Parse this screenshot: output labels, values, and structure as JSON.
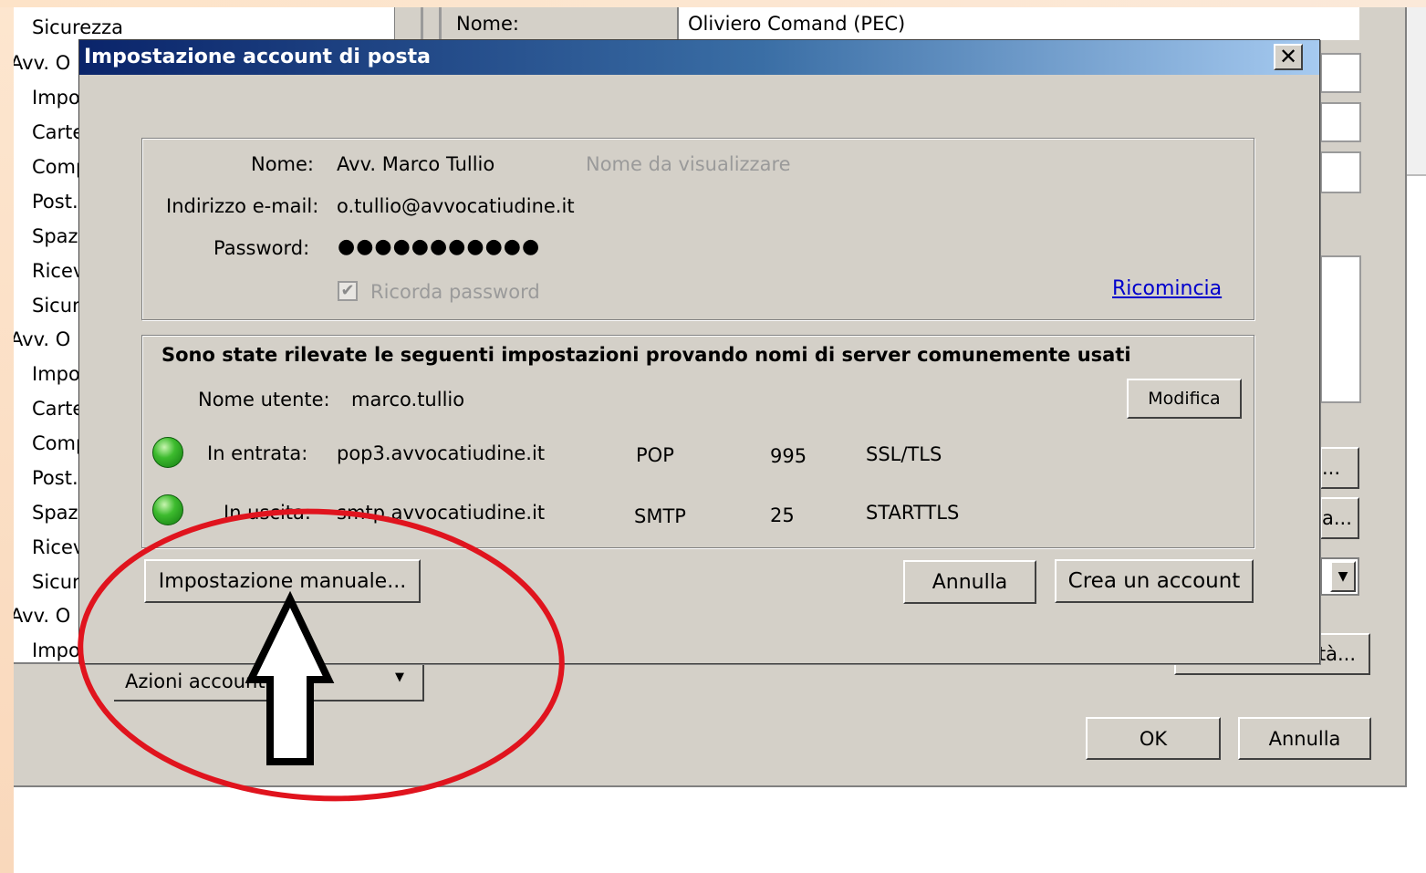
{
  "background_window": {
    "tree_items": [
      "Sicurezza",
      "Avv. O",
      "Impo",
      "Carte",
      "Comp",
      "Post.",
      "Spaz",
      "Ricev",
      "Sicur",
      "Avv. O",
      "Impo",
      "Carte",
      "Comp",
      "Post.",
      "Spaz",
      "Ricev",
      "Sicur",
      "Avv. O",
      "Impo"
    ],
    "name_label": "Nome:",
    "name_value": "Oliviero Comand (PEC)",
    "partial_btn_1": "...",
    "partial_btn_2": "a...",
    "partial_btn_3": "tà...",
    "account_actions_label": "Azioni account",
    "ok_label": "OK",
    "cancel_label": "Annulla"
  },
  "dialog": {
    "title": "Impostazione account di posta",
    "close_glyph": "✕",
    "name_label": "Nome:",
    "name_value": "Avv. Marco Tullio",
    "name_hint": "Nome da visualizzare",
    "email_label": "Indirizzo e-mail:",
    "email_value": "o.tullio@avvocatiudine.it",
    "password_label": "Password:",
    "password_value": "●●●●●●●●●●●",
    "remember_label": "Ricorda password",
    "remember_checked": true,
    "restart_link": "Ricomincia",
    "detected_heading": "Sono state rilevate le seguenti impostazioni provando nomi di server comunemente usati",
    "username_label": "Nome utente:",
    "username_value": "marco.tullio",
    "modify_label": "Modifica",
    "incoming": {
      "label": "In entrata:",
      "server": "pop3.avvocatiudine.it",
      "protocol": "POP",
      "port": "995",
      "security": "SSL/TLS"
    },
    "outgoing": {
      "label": "In uscita:",
      "server": "smtp.avvocatiudine.it",
      "protocol": "SMTP",
      "port": "25",
      "security": "STARTTLS"
    },
    "manual_setup_label": "Impostazione manuale...",
    "cancel_label": "Annulla",
    "create_account_label": "Crea un account"
  },
  "colors": {
    "annotation_ellipse": "#e0141e",
    "arrow_fill": "#ffffff",
    "status_led": "#3dbb2e",
    "titlebar_start": "#0a246a",
    "titlebar_end": "#a6caf0"
  },
  "icons": {
    "status_incoming": "green-status-icon",
    "status_outgoing": "green-status-icon",
    "annotation_arrow": "up-arrow-icon"
  }
}
